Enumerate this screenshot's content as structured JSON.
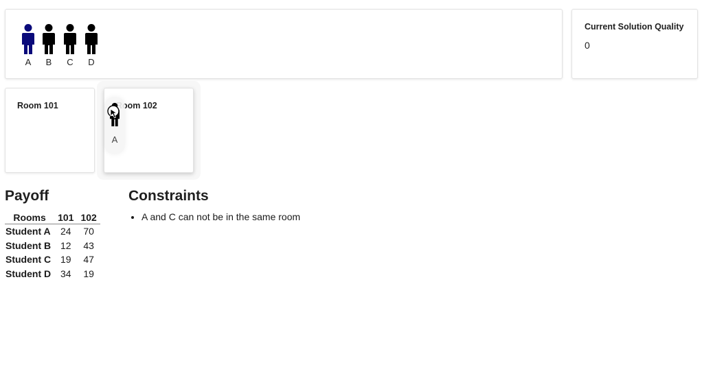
{
  "pool": {
    "students": [
      {
        "label": "A",
        "color": "#0a0a7a",
        "state": "selected"
      },
      {
        "label": "B",
        "color": "#000000"
      },
      {
        "label": "C",
        "color": "#000000"
      },
      {
        "label": "D",
        "color": "#000000"
      }
    ]
  },
  "quality": {
    "title": "Current Solution Quality",
    "value": "0"
  },
  "rooms": [
    {
      "title": "Room 101"
    },
    {
      "title": "Room 102",
      "dragged_student": "A"
    }
  ],
  "payoff": {
    "title": "Payoff",
    "headers": [
      "Rooms",
      "101",
      "102"
    ],
    "rows": [
      {
        "student": "Student A",
        "values": [
          "24",
          "70"
        ]
      },
      {
        "student": "Student B",
        "values": [
          "12",
          "43"
        ]
      },
      {
        "student": "Student C",
        "values": [
          "19",
          "47"
        ]
      },
      {
        "student": "Student D",
        "values": [
          "34",
          "19"
        ]
      }
    ]
  },
  "constraints": {
    "title": "Constraints",
    "items": [
      "A and C can not be in the same room"
    ]
  }
}
